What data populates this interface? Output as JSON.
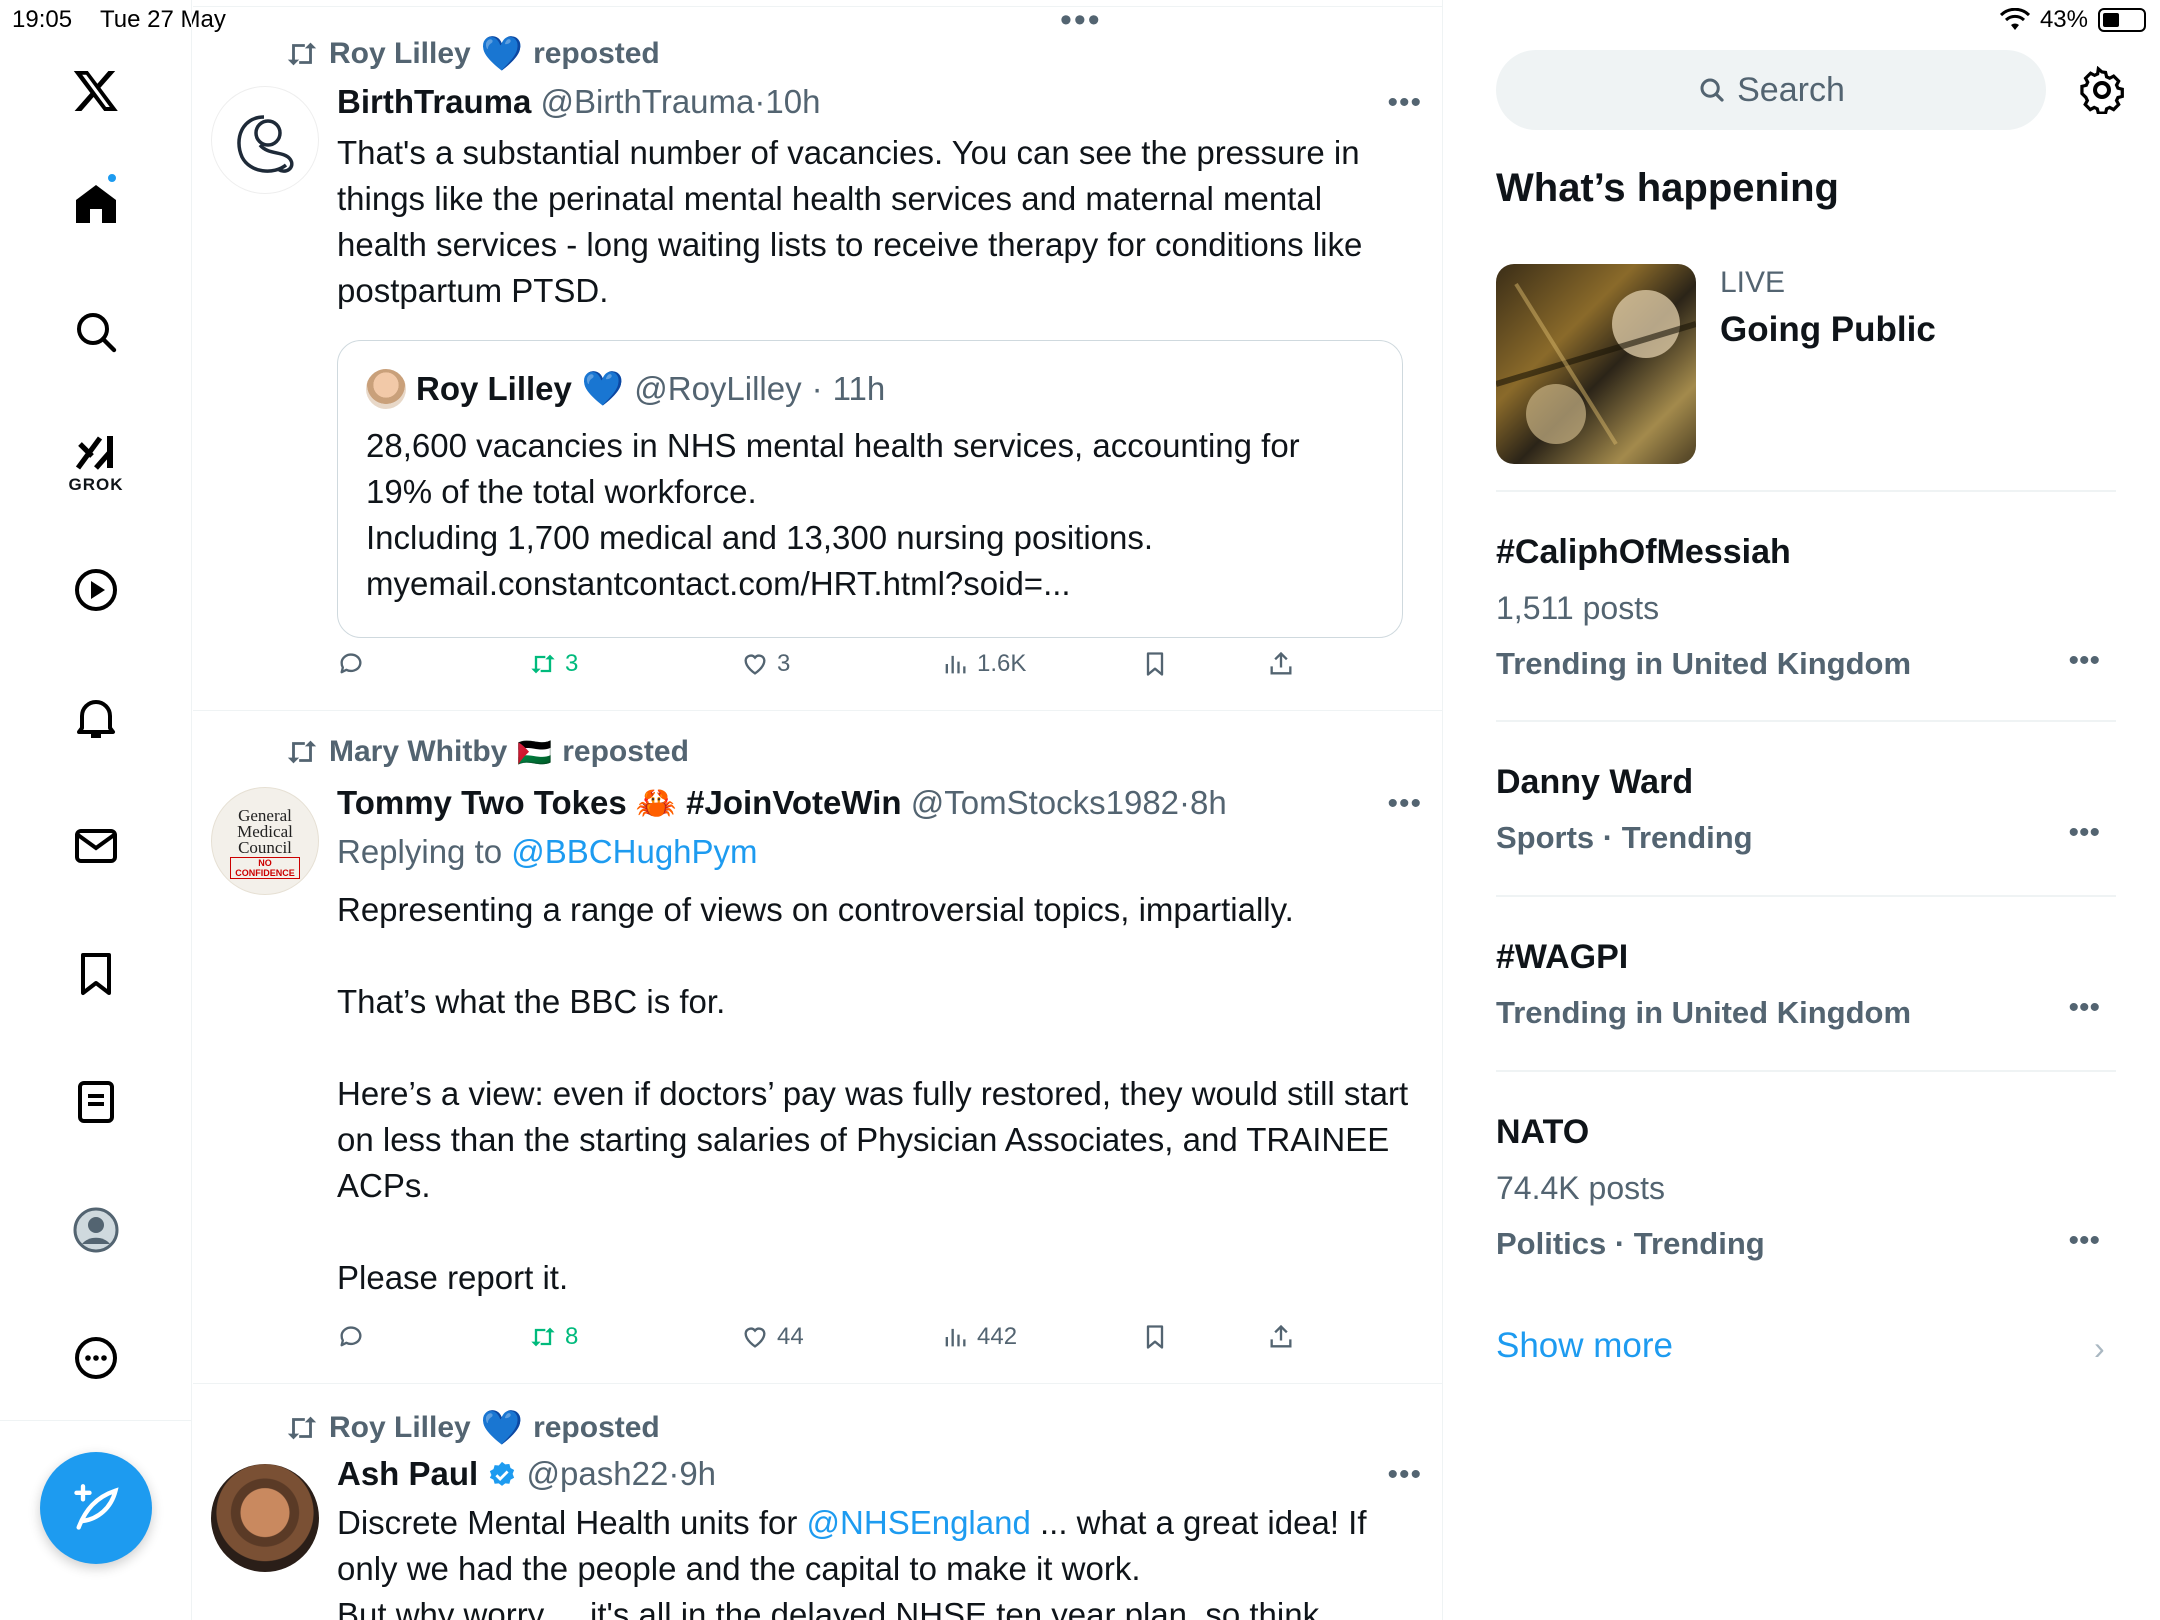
{
  "status_bar": {
    "time": "19:05",
    "date": "Tue 27 May",
    "battery": "43%"
  },
  "nav": {
    "grok_label": "GROK"
  },
  "posts": [
    {
      "reposted_by": "Roy Lilley",
      "reposted_emoji": "💙",
      "reposted_suffix": "reposted",
      "name": "BirthTrauma",
      "handle": "@BirthTrauma",
      "dot": "·",
      "time": "10h",
      "text": "That's a substantial number of vacancies. You can see the pressure in things like the perinatal mental health services and maternal mental health services - long waiting lists to receive therapy for conditions like postpartum PTSD.",
      "quote": {
        "name": "Roy Lilley",
        "emoji": "💙",
        "handle": "@RoyLilley",
        "dot": "·",
        "time": "11h",
        "lines": [
          "28,600 vacancies in NHS mental health services, accounting for 19% of the total workforce.",
          "Including 1,700 medical and 13,300 nursing positions.",
          "myemail.constantcontact.com/HRT.html?soid=..."
        ]
      },
      "stats": {
        "reposts": "3",
        "likes": "3",
        "views": "1.6K"
      }
    },
    {
      "reposted_by": "Mary Whitby",
      "reposted_emoji": "🇵🇸",
      "reposted_suffix": "reposted",
      "name": "Tommy Two Tokes",
      "name_emoji": "🦀",
      "name_tag": "#JoinVoteWin",
      "handle": "@TomStocks1982",
      "dot": "·",
      "time": "8h",
      "reply_prefix": "Replying to",
      "reply_to": "@BBCHughPym",
      "avatar_text": {
        "l1": "General",
        "l2": "Medical",
        "l3": "Council",
        "l4": "NO",
        "l5": "CONFIDENCE"
      },
      "paragraphs": [
        "Representing a range of views on controversial topics, impartially.",
        "That’s what the BBC is for.",
        "Here’s a view:  even if doctors’ pay was fully restored, they would still start on less than the starting salaries of Physician Associates, and TRAINEE ACPs.",
        "Please report it."
      ],
      "stats": {
        "reposts": "8",
        "likes": "44",
        "views": "442"
      }
    },
    {
      "reposted_by": "Roy Lilley",
      "reposted_emoji": "💙",
      "reposted_suffix": "reposted",
      "name": "Ash Paul",
      "handle": "@pash22",
      "dot": "·",
      "time": "9h",
      "text_before": "Discrete Mental Health units for ",
      "mention": "@NHSEngland",
      "text_after": " ... what a great idea! If only we had the people and the capital to make it work.",
      "text_cut": "But why worry ... it's all in the delayed NHSE ten year plan, so think"
    }
  ],
  "right": {
    "search_placeholder": "Search",
    "title": "What’s happening",
    "live": {
      "label": "LIVE",
      "title": "Going Public"
    },
    "trends": [
      {
        "name": "#CaliphOfMessiah",
        "count": "1,511 posts",
        "meta": "Trending in United Kingdom"
      },
      {
        "name": "Danny Ward",
        "count": "",
        "meta": "Sports · Trending"
      },
      {
        "name": "#WAGPI",
        "count": "",
        "meta": "Trending in United Kingdom"
      },
      {
        "name": "NATO",
        "count": "74.4K posts",
        "meta": "Politics · Trending"
      }
    ],
    "show_more": "Show more"
  },
  "colors": {
    "accent": "#1d9bf0",
    "repost_green": "#00ba7c",
    "muted": "#536471"
  },
  "icons": [
    "x-logo-icon",
    "home-icon",
    "search-icon",
    "grok-icon",
    "video-icon",
    "bell-icon",
    "mail-icon",
    "bookmark-icon",
    "lists-icon",
    "profile-icon",
    "more-icon",
    "compose-icon",
    "gear-icon"
  ]
}
